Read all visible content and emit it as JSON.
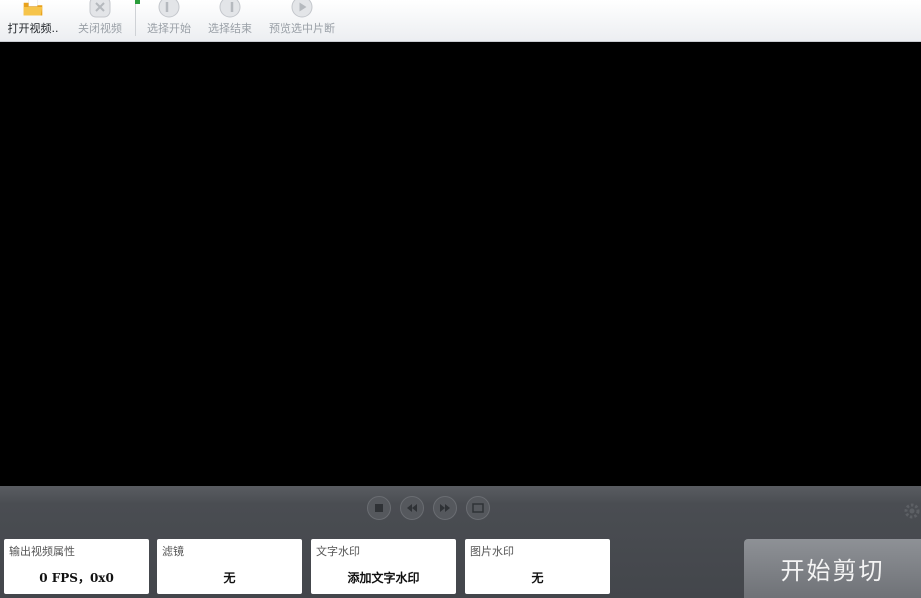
{
  "toolbar": {
    "open_video": {
      "label": "打开视频..",
      "icon": "folder-icon"
    },
    "close_video": {
      "label": "关闭视频",
      "icon": "close-video-icon"
    },
    "select_start": {
      "label": "选择开始",
      "icon": "select-start-icon"
    },
    "select_end": {
      "label": "选择结束",
      "icon": "select-end-icon"
    },
    "preview_segment": {
      "label": "预览选中片断",
      "icon": "preview-icon"
    }
  },
  "playback_controls": [
    "stop-icon",
    "rewind-icon",
    "forward-icon",
    "screen-icon"
  ],
  "options": {
    "output_props": {
      "title": "输出视频属性",
      "value": "0 FPS，0x0"
    },
    "filter": {
      "title": "滤镜",
      "value": "无"
    },
    "text_watermark": {
      "title": "文字水印",
      "value": "添加文字水印"
    },
    "image_watermark": {
      "title": "图片水印",
      "value": "无"
    }
  },
  "start_cut": {
    "label": "开始剪切"
  },
  "colors": {
    "toolbar_bg": "#eceef1",
    "panel_bg": "#4a4d52",
    "video_bg": "#000000",
    "folder": "#f3b52e",
    "disabled_text": "#9aa0a7",
    "start_button": "#7f8287"
  }
}
